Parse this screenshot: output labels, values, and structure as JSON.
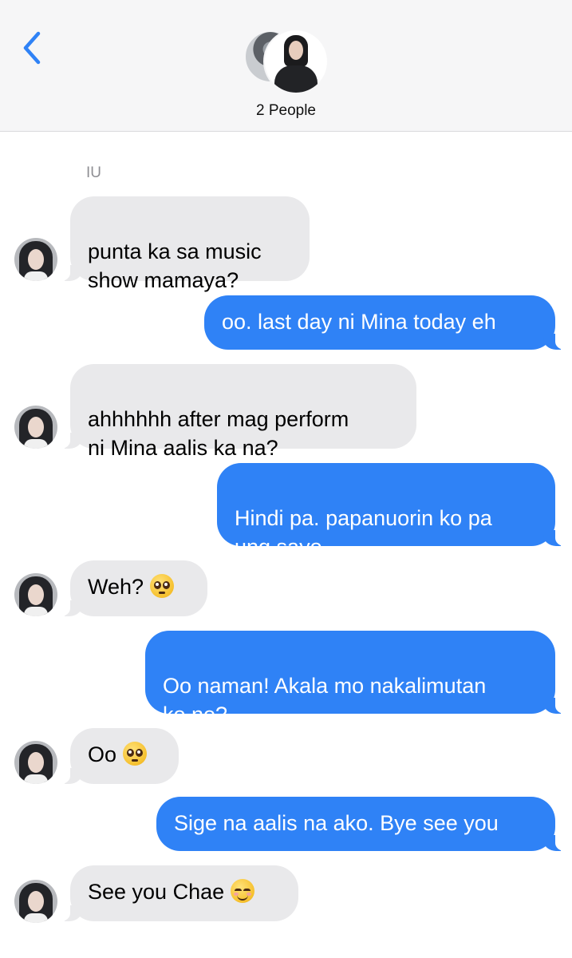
{
  "header": {
    "back_icon": "chevron-left-icon",
    "group_label": "2 People",
    "accent": "#2f82f6"
  },
  "conversation": {
    "sender_name": "IU",
    "messages": [
      {
        "from": "them",
        "text": "punta ka sa music\nshow mamaya?"
      },
      {
        "from": "me",
        "text": "oo. last day ni Mina today eh"
      },
      {
        "from": "them",
        "text": "ahhhhhh after mag perform\nni Mina aalis ka na?"
      },
      {
        "from": "me",
        "text": "Hindi pa. papanuorin ko pa\nung sayo"
      },
      {
        "from": "them",
        "text": "Weh?",
        "emoji": "pleading-face-icon"
      },
      {
        "from": "me",
        "text": "Oo naman! Akala mo nakalimutan\nko no?"
      },
      {
        "from": "them",
        "text": "Oo",
        "emoji": "pleading-face-icon"
      },
      {
        "from": "me",
        "text": "Sige na aalis na ako. Bye see you"
      },
      {
        "from": "them",
        "text": "See you Chae",
        "emoji": "smiling-face-icon"
      }
    ]
  },
  "colors": {
    "incoming_bubble": "#e9e9eb",
    "outgoing_bubble": "#2f82f6",
    "header_bg": "#f6f6f7"
  }
}
